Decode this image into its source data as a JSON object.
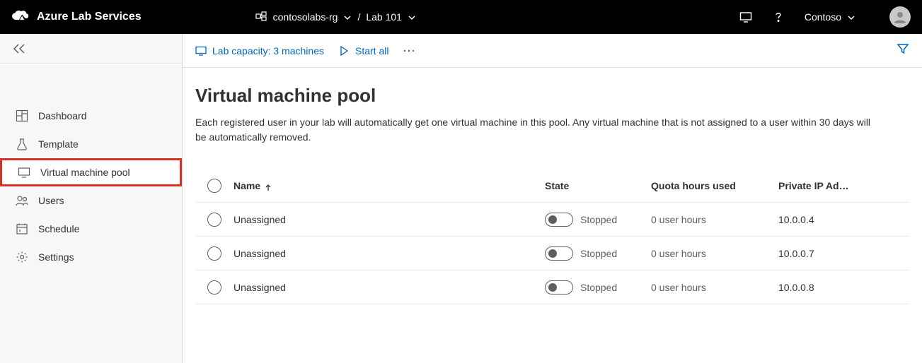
{
  "header": {
    "product": "Azure Lab Services",
    "breadcrumb_rg": "contosolabs-rg",
    "breadcrumb_lab": "Lab 101",
    "separator": "/",
    "user": "Contoso"
  },
  "sidebar": {
    "items": [
      {
        "label": "Dashboard"
      },
      {
        "label": "Template"
      },
      {
        "label": "Virtual machine pool"
      },
      {
        "label": "Users"
      },
      {
        "label": "Schedule"
      },
      {
        "label": "Settings"
      }
    ]
  },
  "toolbar": {
    "capacity": "Lab capacity: 3 machines",
    "start_all": "Start all"
  },
  "page": {
    "title": "Virtual machine pool",
    "desc": "Each registered user in your lab will automatically get one virtual machine in this pool. Any virtual machine that is not assigned to a user within 30 days will be automatically removed."
  },
  "table": {
    "headers": {
      "name": "Name",
      "state": "State",
      "quota": "Quota hours used",
      "ip": "Private IP Ad…"
    },
    "rows": [
      {
        "name": "Unassigned",
        "state": "Stopped",
        "quota": "0 user hours",
        "ip": "10.0.0.4"
      },
      {
        "name": "Unassigned",
        "state": "Stopped",
        "quota": "0 user hours",
        "ip": "10.0.0.7"
      },
      {
        "name": "Unassigned",
        "state": "Stopped",
        "quota": "0 user hours",
        "ip": "10.0.0.8"
      }
    ]
  }
}
